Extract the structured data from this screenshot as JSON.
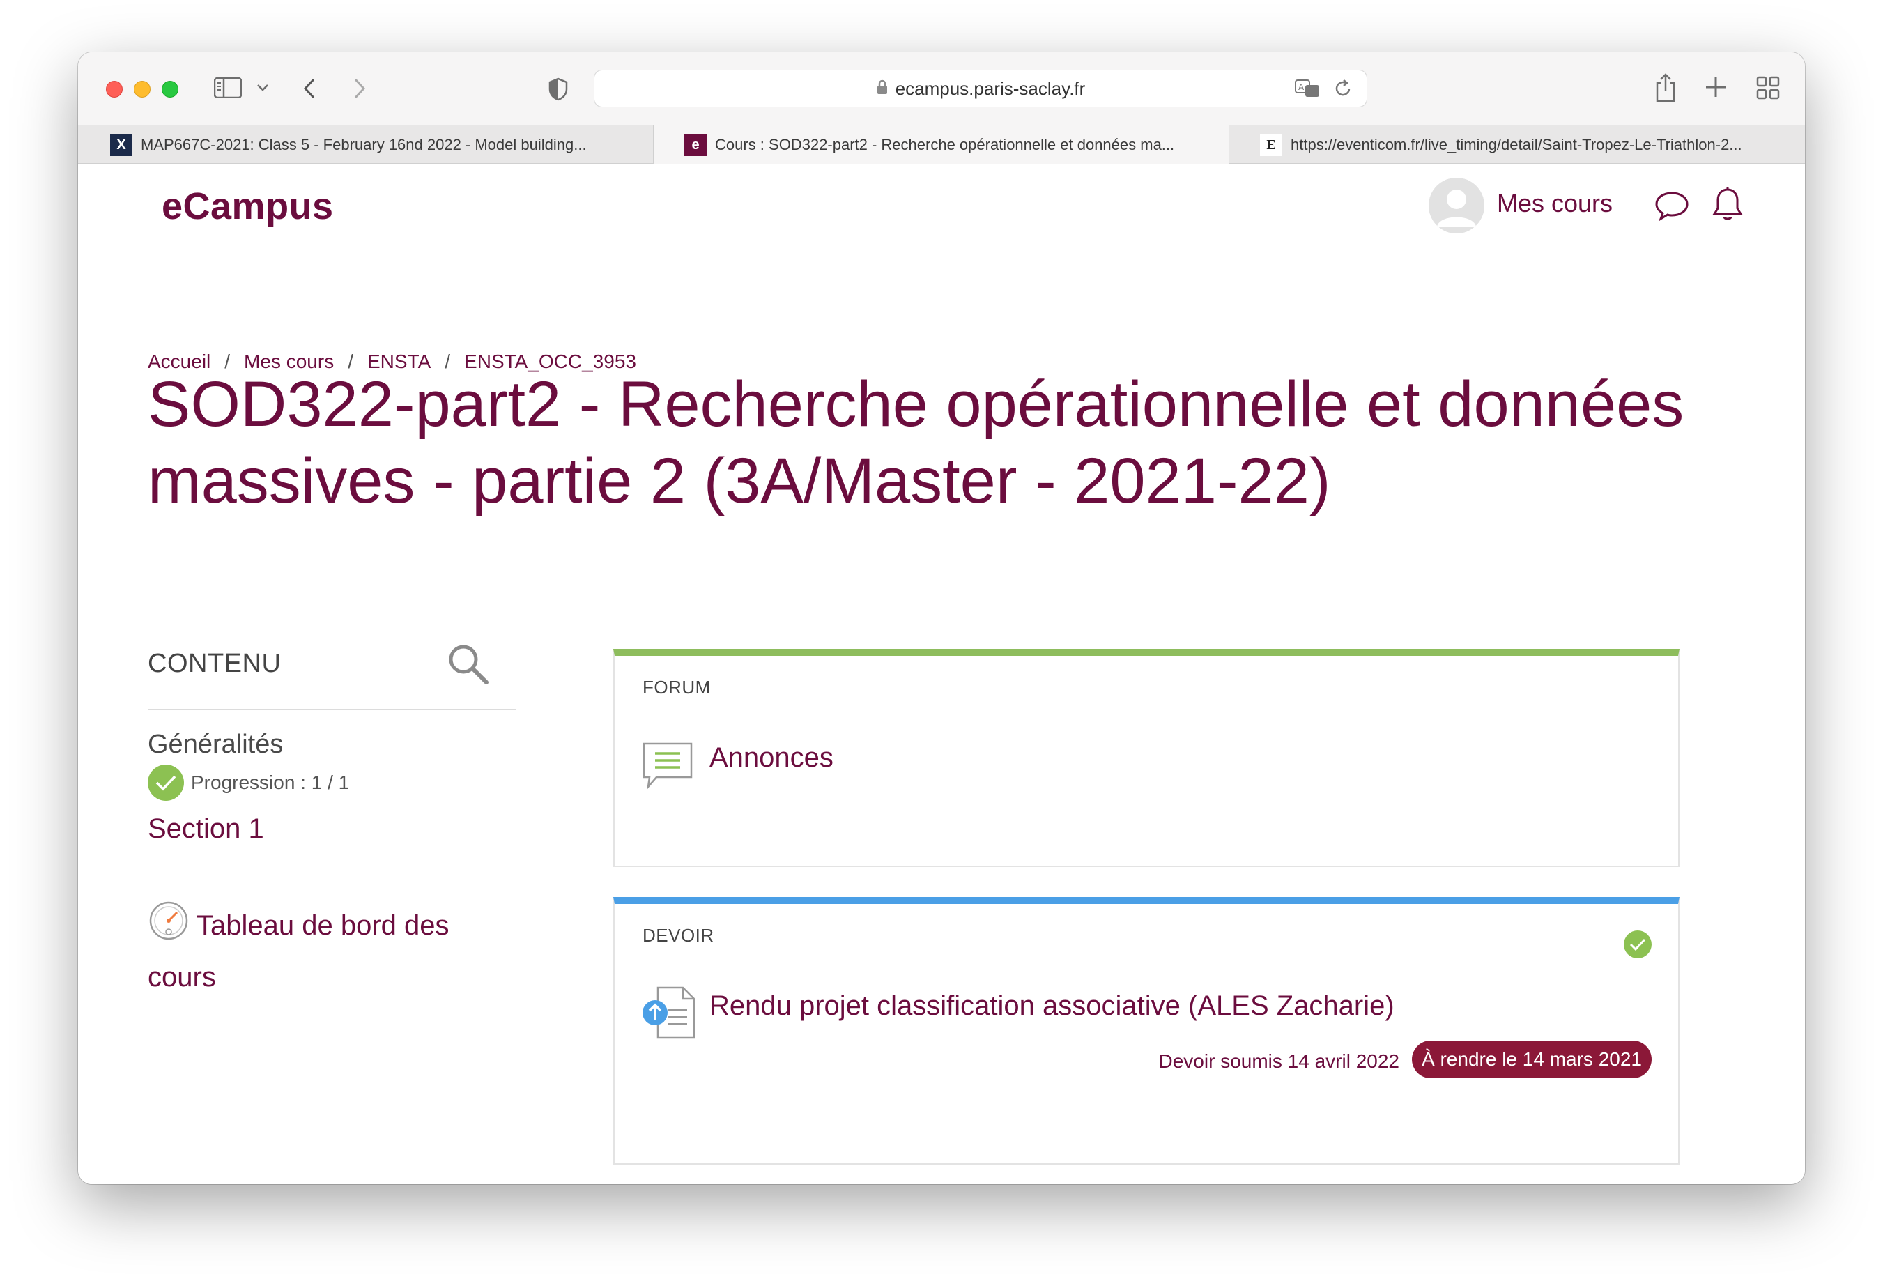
{
  "browser": {
    "url": "ecampus.paris-saclay.fr",
    "tabs": [
      {
        "label": "MAP667C-2021: Class 5 - February 16nd 2022 - Model building...",
        "favicon": "X"
      },
      {
        "label": "Cours : SOD322-part2 - Recherche opérationnelle et données ma...",
        "favicon": "e"
      },
      {
        "label": "https://eventicom.fr/live_timing/detail/Saint-Tropez-Le-Triathlon-2...",
        "favicon": "E"
      }
    ]
  },
  "header": {
    "logo": "eCampus",
    "mes_cours": "Mes cours"
  },
  "breadcrumb": {
    "items": [
      "Accueil",
      "Mes cours",
      "ENSTA",
      "ENSTA_OCC_3953"
    ],
    "separator": "/"
  },
  "course": {
    "title": "SOD322-part2 - Recherche opérationnelle et données massives - partie 2 (3A/Master - 2021-22)"
  },
  "sidebar": {
    "heading": "CONTENU",
    "sections": [
      {
        "label": "Généralités",
        "progress": "Progression : 1 / 1"
      },
      {
        "label": "Section 1"
      }
    ],
    "dashboard": "Tableau de bord des cours"
  },
  "activities": [
    {
      "type": "FORUM",
      "title": "Annonces",
      "accent": "#8ebd5d"
    },
    {
      "type": "DEVOIR",
      "title": "Rendu projet classification associative (ALES Zacharie)",
      "accent": "#4a9fe6",
      "submitted": "Devoir soumis 14 avril 2022",
      "due": "À rendre le 14 mars 2021"
    }
  ],
  "colors": {
    "brand": "#6b0d3e",
    "badge": "#8b1838",
    "check": "#8cc152"
  }
}
